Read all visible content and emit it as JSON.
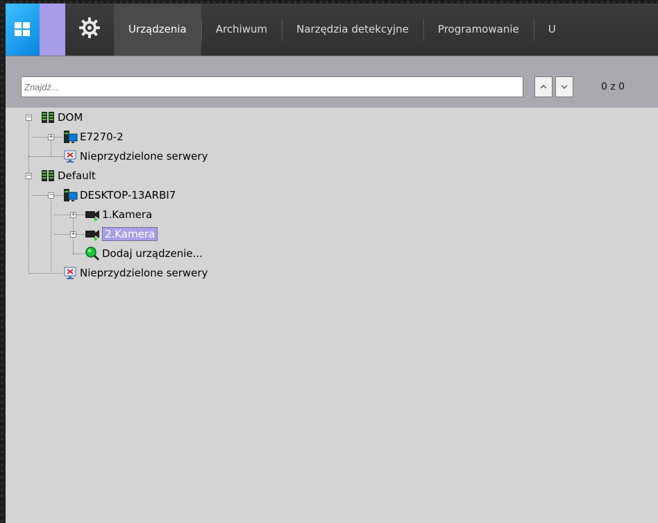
{
  "topbar": {
    "tabs": [
      {
        "label": "Urządzenia",
        "active": true
      },
      {
        "label": "Archiwum",
        "active": false
      },
      {
        "label": "Narzędzia detekcyjne",
        "active": false
      },
      {
        "label": "Programowanie",
        "active": false
      },
      {
        "label": "U",
        "active": false
      }
    ]
  },
  "search": {
    "placeholder": "Znajdź...",
    "value": "",
    "counter": "0 z 0"
  },
  "tree": {
    "dom": "DOM",
    "e7270": "E7270-2",
    "unassigned1": "Nieprzydzielone serwery",
    "default": "Default",
    "desktop": "DESKTOP-13ARBI7",
    "cam1": "1.Kamera",
    "cam2": "2.Kamera",
    "add": "Dodaj urządzenie...",
    "unassigned2": "Nieprzydzielone serwery"
  },
  "colors": {
    "accent_blue": "#1a9cf0",
    "lavender": "#a89ee8",
    "selection": "#a8a0e8",
    "panel_bg": "#d4d4d4"
  }
}
